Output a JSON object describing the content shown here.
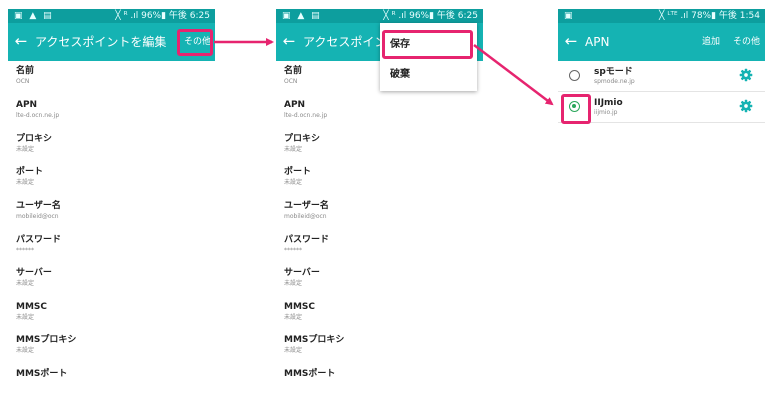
{
  "status_bar": [
    {
      "left": "▣ ▲ ▤",
      "right": "╳ ᴿ .ıl 96%▮ 午後 6:25"
    },
    {
      "left": "▣ ▲ ▤",
      "right": "╳ ᴿ .ıl 96%▮ 午後 6:25"
    },
    {
      "left": "▣",
      "right": "╳ ᴸᵀᴱ .ıl 78%▮ 午後 1:54"
    }
  ],
  "screen1": {
    "title": "アクセスポイントを編集",
    "more_label": "その他",
    "fields": [
      {
        "label": "名前",
        "value": "OCN"
      },
      {
        "label": "APN",
        "value": "lte-d.ocn.ne.jp"
      },
      {
        "label": "プロキシ",
        "value": "未設定"
      },
      {
        "label": "ポート",
        "value": "未設定"
      },
      {
        "label": "ユーザー名",
        "value": "mobileid@ocn"
      },
      {
        "label": "パスワード",
        "value": "******"
      },
      {
        "label": "サーバー",
        "value": "未設定"
      },
      {
        "label": "MMSC",
        "value": "未設定"
      },
      {
        "label": "MMSプロキシ",
        "value": "未設定"
      },
      {
        "label": "MMSポート",
        "value": ""
      }
    ]
  },
  "screen2": {
    "title": "アクセスポイント",
    "fields": [
      {
        "label": "名前",
        "value": "OCN"
      },
      {
        "label": "APN",
        "value": "lte-d.ocn.ne.jp"
      },
      {
        "label": "プロキシ",
        "value": "未設定"
      },
      {
        "label": "ポート",
        "value": "未設定"
      },
      {
        "label": "ユーザー名",
        "value": "mobileid@ocn"
      },
      {
        "label": "パスワード",
        "value": "******"
      },
      {
        "label": "サーバー",
        "value": "未設定"
      },
      {
        "label": "MMSC",
        "value": "未設定"
      },
      {
        "label": "MMSプロキシ",
        "value": "未設定"
      },
      {
        "label": "MMSポート",
        "value": ""
      }
    ],
    "menu": {
      "save_label": "保存",
      "discard_label": "破棄"
    }
  },
  "screen3": {
    "title": "APN",
    "add_label": "追加",
    "more_label": "その他",
    "apns": [
      {
        "name": "spモード",
        "apn": "spmode.ne.jp",
        "selected": false
      },
      {
        "name": "IIJmio",
        "apn": "iijmio.jp",
        "selected": true
      }
    ]
  },
  "colors": {
    "accent": "#15b3b3",
    "status_bar": "#0d9e9e",
    "highlight": "#e6246f",
    "radio_selected": "#2aa65a"
  },
  "icons": {
    "back": "arrow-left-icon",
    "gear": "gear-icon",
    "radio": "radio-icon"
  }
}
